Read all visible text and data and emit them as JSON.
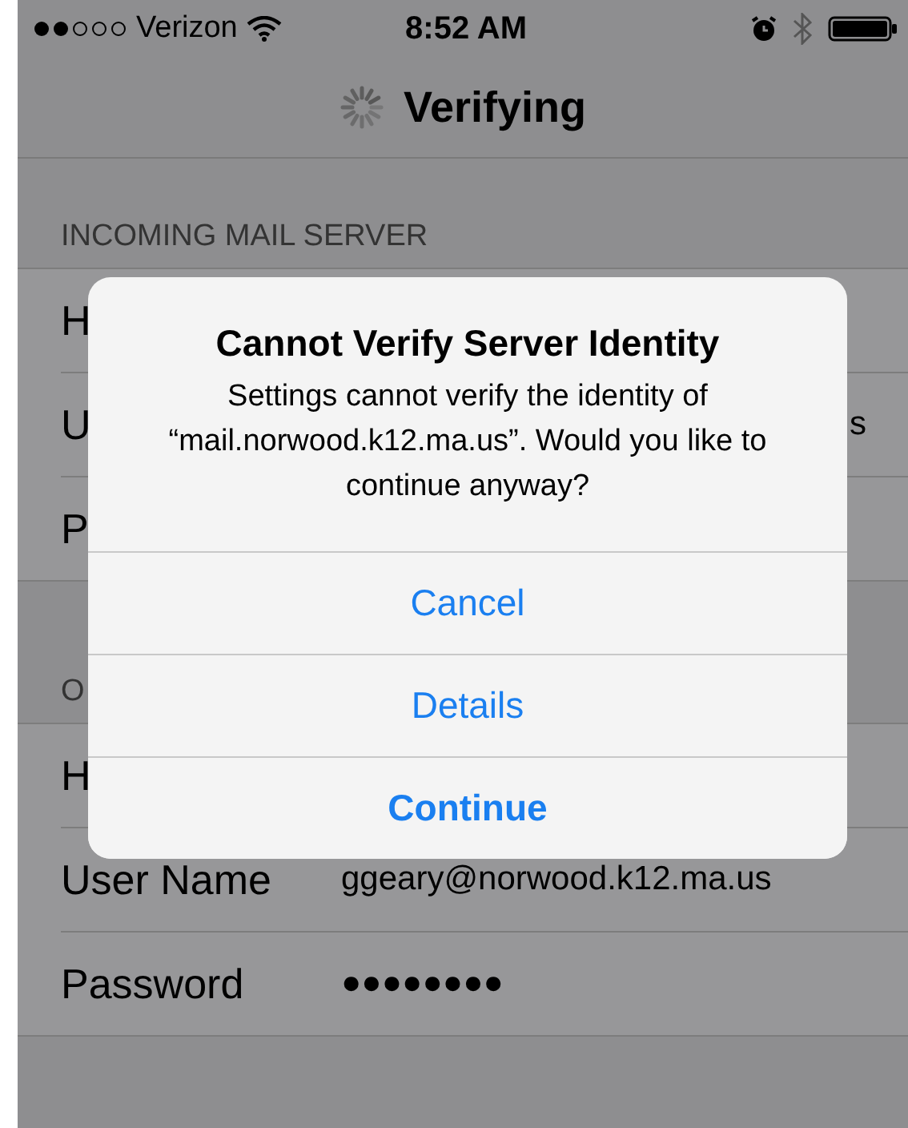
{
  "status_bar": {
    "carrier": "Verizon",
    "time": "8:52 AM"
  },
  "nav": {
    "title": "Verifying"
  },
  "sections": [
    {
      "header": "INCOMING MAIL SERVER",
      "rows": [
        {
          "label": "H"
        },
        {
          "label": "U",
          "value": "s"
        },
        {
          "label": "P"
        }
      ]
    },
    {
      "header": "O",
      "rows": [
        {
          "label": "H"
        },
        {
          "label": "User Name",
          "value": "ggeary@norwood.k12.ma.us"
        },
        {
          "label": "Password",
          "value": "●●●●●●●●"
        }
      ]
    }
  ],
  "alert": {
    "title": "Cannot Verify Server Identity",
    "message": "Settings cannot verify the identity of “mail.norwood.k12.ma.us”. Would you like to continue anyway?",
    "buttons": [
      {
        "label": "Cancel",
        "kind": "default"
      },
      {
        "label": "Details",
        "kind": "default"
      },
      {
        "label": "Continue",
        "kind": "preferred"
      }
    ]
  }
}
